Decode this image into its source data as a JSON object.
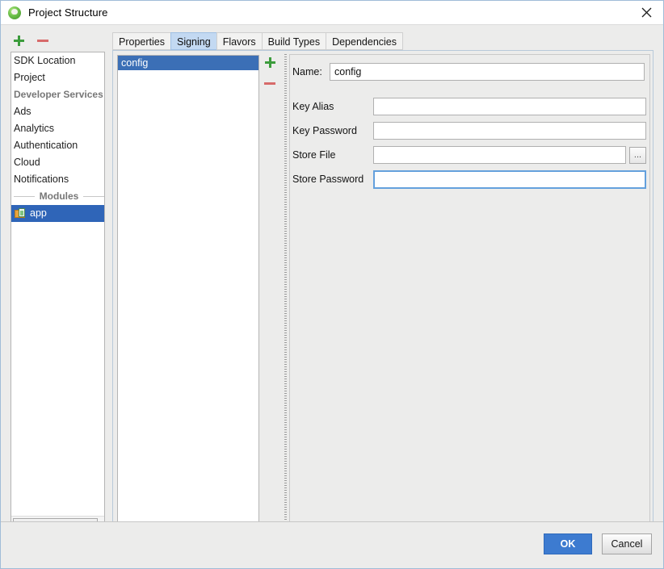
{
  "window": {
    "title": "Project Structure",
    "app_icon": "android-studio-icon",
    "close_icon": "close-icon"
  },
  "sidebar": {
    "toolbar": {
      "add_icon": "plus-icon",
      "remove_icon": "minus-icon"
    },
    "items": [
      {
        "label": "SDK Location",
        "type": "item",
        "selected": false
      },
      {
        "label": "Project",
        "type": "item",
        "selected": false
      },
      {
        "label": "Developer Services",
        "type": "group-left"
      },
      {
        "label": "Ads",
        "type": "item",
        "selected": false
      },
      {
        "label": "Analytics",
        "type": "item",
        "selected": false
      },
      {
        "label": "Authentication",
        "type": "item",
        "selected": false
      },
      {
        "label": "Cloud",
        "type": "item",
        "selected": false
      },
      {
        "label": "Notifications",
        "type": "item",
        "selected": false
      },
      {
        "label": "Modules",
        "type": "group-center"
      },
      {
        "label": "app",
        "type": "module",
        "selected": true,
        "icon": "module-icon"
      }
    ],
    "scrollbar": "horizontal-scrollbar"
  },
  "tabs": [
    {
      "label": "Properties",
      "active": false
    },
    {
      "label": "Signing",
      "active": true
    },
    {
      "label": "Flavors",
      "active": false
    },
    {
      "label": "Build Types",
      "active": false
    },
    {
      "label": "Dependencies",
      "active": false
    }
  ],
  "config_list": {
    "items": [
      {
        "label": "config",
        "selected": true
      }
    ],
    "add_icon": "plus-icon",
    "remove_icon": "minus-icon"
  },
  "form": {
    "name_label": "Name:",
    "name_value": "config",
    "name_placeholder": "",
    "fields": [
      {
        "label": "Key Alias",
        "value": "",
        "placeholder": "",
        "browse": false,
        "focused": false
      },
      {
        "label": "Key Password",
        "value": "",
        "placeholder": "",
        "browse": false,
        "focused": false
      },
      {
        "label": "Store File",
        "value": "",
        "placeholder": "",
        "browse": true,
        "browse_label": "...",
        "focused": false
      },
      {
        "label": "Store Password",
        "value": "",
        "placeholder": "",
        "browse": false,
        "focused": true
      }
    ]
  },
  "footer": {
    "ok_label": "OK",
    "cancel_label": "Cancel"
  },
  "colors": {
    "accent_blue": "#3d7bd0",
    "selection_blue": "#3b6fb6",
    "tab_active_blue": "#c3d9f2",
    "focus_blue": "#63a0dd",
    "panel_gray": "#ececeb",
    "add_green": "#3c9c3c",
    "remove_red": "#d76a6a"
  }
}
